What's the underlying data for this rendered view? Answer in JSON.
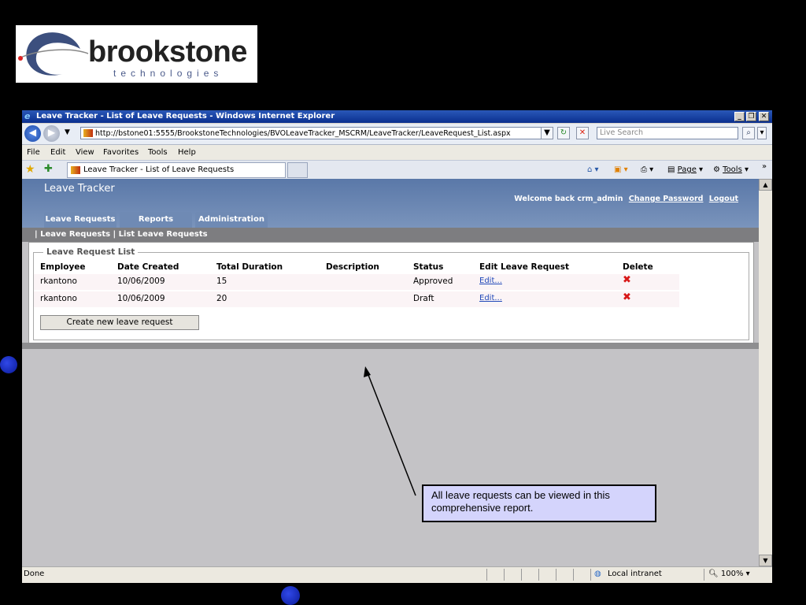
{
  "logo": {
    "brand": "brookstone",
    "sub": "technologies"
  },
  "window": {
    "title": "Leave Tracker - List of Leave Requests - Windows Internet Explorer"
  },
  "address": {
    "url": "http://bstone01:5555/BrookstoneTechnologies/BVOLeaveTracker_MSCRM/LeaveTracker/LeaveRequest_List.aspx"
  },
  "search": {
    "placeholder": "Live Search"
  },
  "menu": [
    "File",
    "Edit",
    "View",
    "Favorites",
    "Tools",
    "Help"
  ],
  "tab": {
    "label": "Leave Tracker - List of Leave Requests"
  },
  "commands": {
    "page": "Page",
    "tools": "Tools"
  },
  "app": {
    "title": "Leave Tracker",
    "welcome": "Welcome back crm_admin",
    "change_password": "Change Password",
    "logout": "Logout",
    "nav": [
      "Leave Requests",
      "Reports",
      "Administration"
    ],
    "breadcrumb": "| Leave Requests | List Leave Requests"
  },
  "list": {
    "legend": "Leave Request List",
    "columns": [
      "Employee",
      "Date Created",
      "Total Duration",
      "Description",
      "Status",
      "Edit Leave Request",
      "Delete"
    ],
    "rows": [
      {
        "employee": "rkantono",
        "date": "10/06/2009",
        "duration": "15",
        "description": "",
        "status": "Approved",
        "edit": "Edit..."
      },
      {
        "employee": "rkantono",
        "date": "10/06/2009",
        "duration": "20",
        "description": "",
        "status": "Draft",
        "edit": "Edit..."
      }
    ],
    "create_label": "Create new leave request"
  },
  "callout": {
    "text": "All leave requests can be viewed in this comprehensive report."
  },
  "status": {
    "left": "Done",
    "zone": "Local intranet",
    "zoom": "100%"
  }
}
